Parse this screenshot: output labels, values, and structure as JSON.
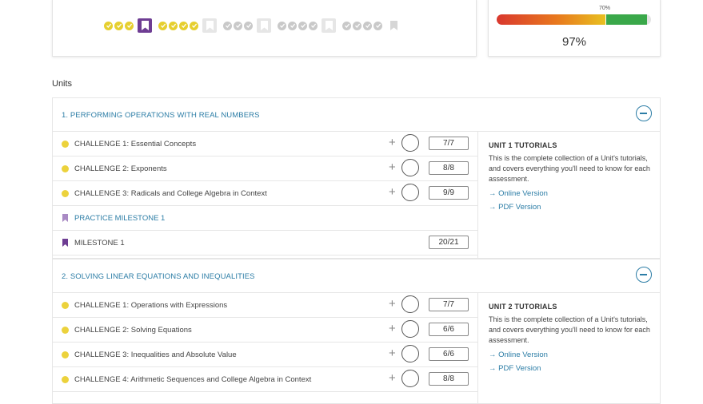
{
  "progress_track": {
    "groups": [
      {
        "completed": 3,
        "total": 3,
        "flag": "active"
      },
      {
        "completed": 4,
        "total": 4,
        "flag": "inactive"
      },
      {
        "completed": 0,
        "total": 3,
        "flag": "inactive"
      },
      {
        "completed": 0,
        "total": 4,
        "flag": "inactive"
      },
      {
        "completed": 0,
        "total": 4,
        "flag": "plain"
      }
    ]
  },
  "score_card": {
    "threshold_label": "70%",
    "percent_text": "97%",
    "percent_value": 0.97,
    "colors": {
      "low": "#d9382e",
      "mid": "#e8c020",
      "pass": "#3aa84a"
    }
  },
  "units_heading": "Units",
  "units": [
    {
      "title": "1. PERFORMING OPERATIONS WITH REAL NUMBERS",
      "rows": [
        {
          "label": "CHALLENGE 1: Essential Concepts",
          "score": "7/7"
        },
        {
          "label": "CHALLENGE 2: Exponents",
          "score": "8/8"
        },
        {
          "label": "CHALLENGE 3: Radicals and College Algebra in Context",
          "score": "9/9"
        },
        {
          "label": "PRACTICE MILESTONE 1",
          "score": ""
        },
        {
          "label": "MILESTONE 1",
          "score": "20/21"
        }
      ],
      "tutorials": {
        "title": "UNIT 1 TUTORIALS",
        "description": "This is the complete collection of a Unit's tutorials, and covers everything you'll need to know for each assessment.",
        "online_link": "→ Online Version",
        "pdf_link": "→ PDF Version"
      }
    },
    {
      "title": "2. SOLVING LINEAR EQUATIONS AND INEQUALITIES",
      "rows": [
        {
          "label": "CHALLENGE 1: Operations with Expressions",
          "score": "7/7"
        },
        {
          "label": "CHALLENGE 2: Solving Equations",
          "score": "6/6"
        },
        {
          "label": "CHALLENGE 3: Inequalities and Absolute Value",
          "score": "6/6"
        },
        {
          "label": "CHALLENGE 4: Arithmetic Sequences and College Algebra in Context",
          "score": "8/8"
        }
      ],
      "tutorials": {
        "title": "UNIT 2 TUTORIALS",
        "description": "This is the complete collection of a Unit's tutorials, and covers everything you'll need to know for each assessment.",
        "online_link": "→ Online Version",
        "pdf_link": "→ PDF Version"
      }
    }
  ]
}
